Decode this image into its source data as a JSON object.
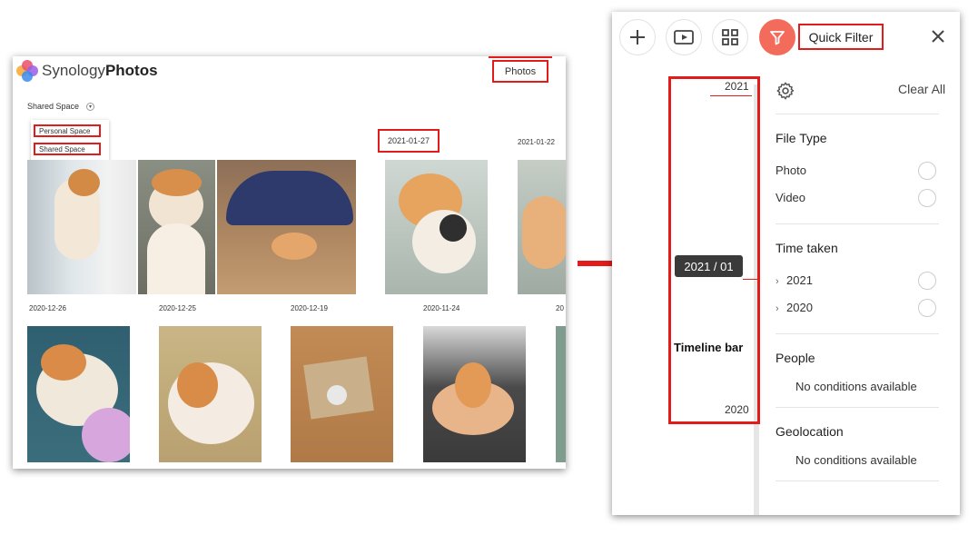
{
  "app": {
    "brand_light": "Synology",
    "brand_bold": "Photos",
    "photos_button": "Photos",
    "space_selector": "Shared Space",
    "space_menu": [
      "Personal Space",
      "Shared Space"
    ]
  },
  "dates": {
    "row1": [
      "2021-01-27",
      "2021-01-22"
    ],
    "row2": [
      "2020-12-26",
      "2020-12-25",
      "2020-12-19",
      "2020-11-24",
      "20"
    ]
  },
  "panel": {
    "quick_filter_label": "Quick Filter",
    "timeline": {
      "year_top": "2021",
      "year_bottom": "2020",
      "badge": "2021 / 01",
      "caption": "Timeline bar"
    },
    "clear_all": "Clear All",
    "sections": {
      "file_type": {
        "title": "File Type",
        "options": [
          "Photo",
          "Video"
        ]
      },
      "time_taken": {
        "title": "Time taken",
        "options": [
          "2021",
          "2020"
        ]
      },
      "people": {
        "title": "People",
        "empty": "No conditions available"
      },
      "geolocation": {
        "title": "Geolocation",
        "empty": "No conditions available"
      }
    }
  },
  "colors": {
    "highlight_red": "#e21b1b",
    "filter_active": "#f26b5b",
    "badge_bg": "#3a3a3a"
  },
  "icons": [
    "plus-icon",
    "slideshow-icon",
    "grid-icon",
    "filter-icon",
    "close-icon",
    "gear-icon",
    "chevron-right-icon",
    "arrow-right-icon"
  ]
}
